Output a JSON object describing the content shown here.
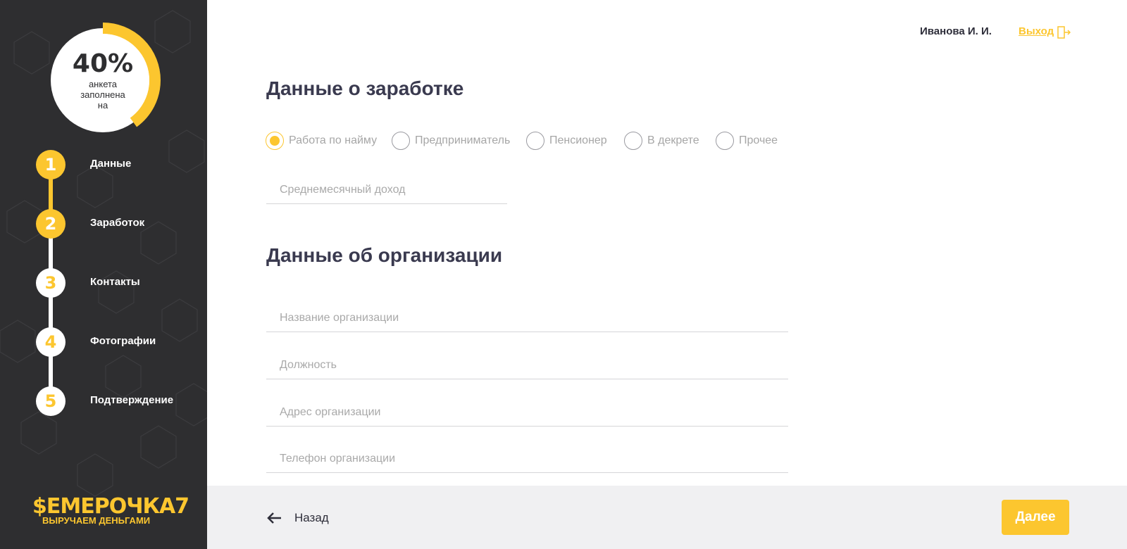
{
  "progress": {
    "value": 0.4,
    "percent_label": "40%",
    "caption": "анкета заполнена на"
  },
  "steps": [
    {
      "number": "1",
      "label": "Данные",
      "state": "done"
    },
    {
      "number": "2",
      "label": "Заработок",
      "state": "active"
    },
    {
      "number": "3",
      "label": "Контакты",
      "state": "pending"
    },
    {
      "number": "4",
      "label": "Фотографии",
      "state": "pending"
    },
    {
      "number": "5",
      "label": "Подтверждение",
      "state": "pending"
    }
  ],
  "logo": {
    "main": "$ЕМЕРОЧКА7",
    "tagline": "ВЫРУЧАЕМ ДЕНЬГАМИ"
  },
  "header": {
    "user_name": "Иванова И. И.",
    "logout_label": "Выход"
  },
  "income": {
    "title": "Данные о заработке",
    "employment_options": [
      {
        "label": "Работа по найму",
        "checked": true
      },
      {
        "label": "Предприниматель",
        "checked": false
      },
      {
        "label": "Пенсионер",
        "checked": false
      },
      {
        "label": "В декрете",
        "checked": false
      },
      {
        "label": "Прочее",
        "checked": false
      }
    ],
    "monthly_income": {
      "value": "",
      "placeholder": "Среднемесячный доход"
    }
  },
  "organization": {
    "title": "Данные об организации",
    "fields": {
      "name": {
        "value": "",
        "placeholder": "Название организации"
      },
      "position": {
        "value": "",
        "placeholder": "Должность"
      },
      "address": {
        "value": "",
        "placeholder": "Адрес организации"
      },
      "phone": {
        "value": "",
        "placeholder": "Телефон организации"
      }
    }
  },
  "footer": {
    "back_label": "Назад",
    "next_label": "Далее"
  },
  "colors": {
    "accent": "#fcc62f",
    "sidebar_bg": "#2e2e30",
    "footer_bg": "#f0f0f2",
    "title": "#3a3a4f"
  },
  "icons": {
    "logout": "logout-door-icon",
    "back": "arrow-left-icon"
  }
}
